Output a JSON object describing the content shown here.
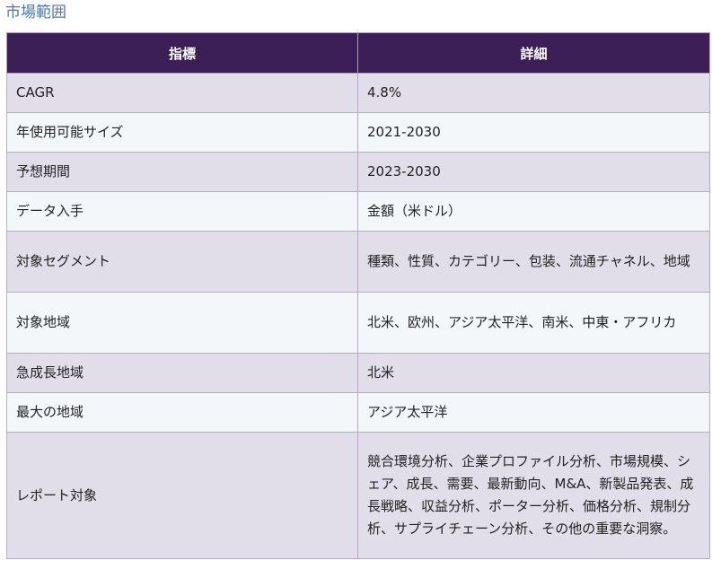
{
  "section_title": "市場範囲",
  "table": {
    "headers": [
      "指標",
      "詳細"
    ],
    "rows": [
      {
        "metric": "CAGR",
        "detail": "4.8%"
      },
      {
        "metric": "年使用可能サイズ",
        "detail": "2021-2030"
      },
      {
        "metric": "予想期間",
        "detail": "2023-2030"
      },
      {
        "metric": "データ入手",
        "detail": "金額（米ドル）"
      },
      {
        "metric": "対象セグメント",
        "detail": "種類、性質、カテゴリー、包装、流通チャネル、地域"
      },
      {
        "metric": "対象地域",
        "detail": "北米、欧州、アジア太平洋、南米、中東・アフリカ"
      },
      {
        "metric": "急成長地域",
        "detail": "北米"
      },
      {
        "metric": "最大の地域",
        "detail": "アジア太平洋"
      },
      {
        "metric": "レポート対象",
        "detail": "競合環境分析、企業プロファイル分析、市場規模、シェア、成長、需要、最新動向、M&A、新製品発表、成長戦略、収益分析、ポーター分析、価格分析、規制分析、サプライチェーン分析、その他の重要な洞察。"
      }
    ]
  }
}
